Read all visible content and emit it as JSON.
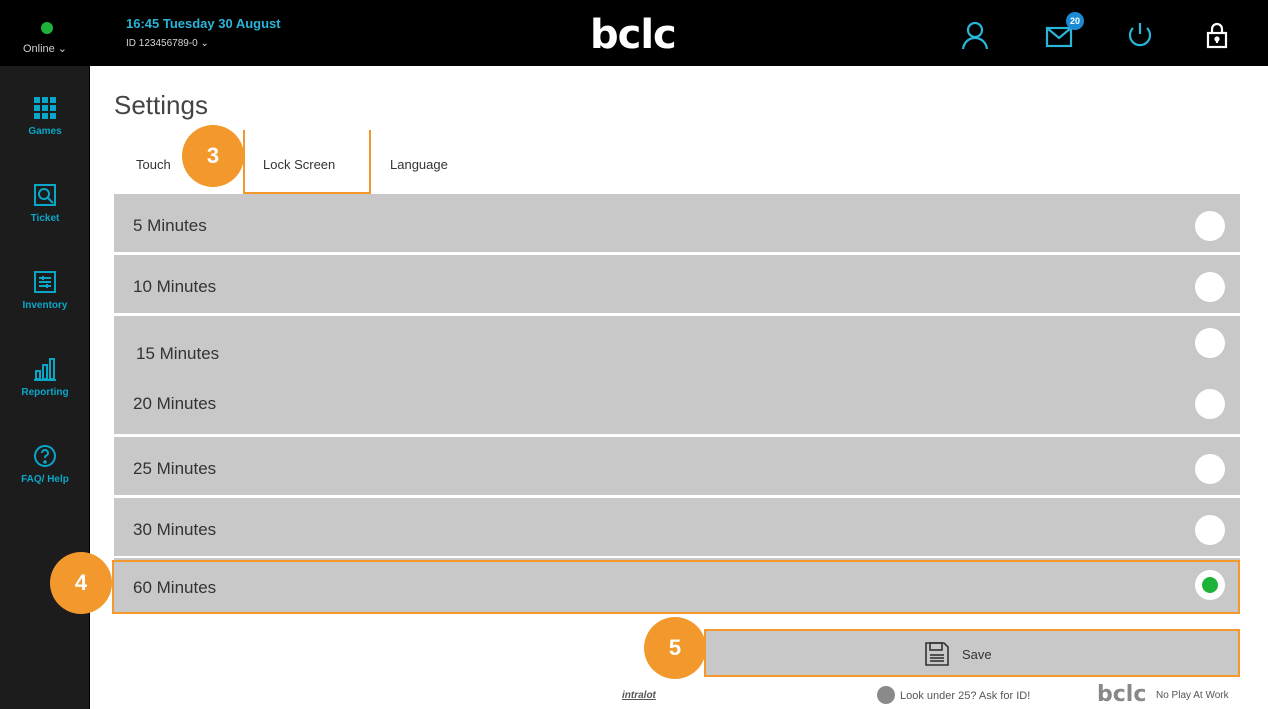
{
  "sidebar": {
    "status": "Online",
    "items": [
      {
        "label": "Games"
      },
      {
        "label": "Ticket"
      },
      {
        "label": "Inventory"
      },
      {
        "label": "Reporting"
      },
      {
        "label": "FAQ/ Help"
      }
    ]
  },
  "header": {
    "datetime": "16:45 Tuesday 30 August",
    "terminal_id": "ID 123456789-0",
    "brand": "bclc",
    "messages_badge": "20"
  },
  "page": {
    "title": "Settings",
    "tabs": [
      {
        "label": "Touch",
        "selected": false
      },
      {
        "label": "Lock Screen",
        "selected": true
      },
      {
        "label": "Language",
        "selected": false
      }
    ]
  },
  "options": [
    {
      "label": "5 Minutes",
      "selected": false
    },
    {
      "label": "10 Minutes",
      "selected": false
    },
    {
      "label": "15 Minutes",
      "selected": false
    },
    {
      "label": "20 Minutes",
      "selected": false
    },
    {
      "label": "25 Minutes",
      "selected": false
    },
    {
      "label": "30 Minutes",
      "selected": false
    },
    {
      "label": "60 Minutes",
      "selected": true
    }
  ],
  "save_label": "Save",
  "callouts": [
    "3",
    "4",
    "5"
  ],
  "footer": {
    "intralot": "intralot",
    "id_message": "Look under 25? Ask for ID!",
    "brand": "bclc",
    "tagline": "No Play At Work"
  },
  "colors": {
    "accent_orange": "#f2982c",
    "selected_green": "#1fb239",
    "header_blue": "#29b6d9"
  }
}
